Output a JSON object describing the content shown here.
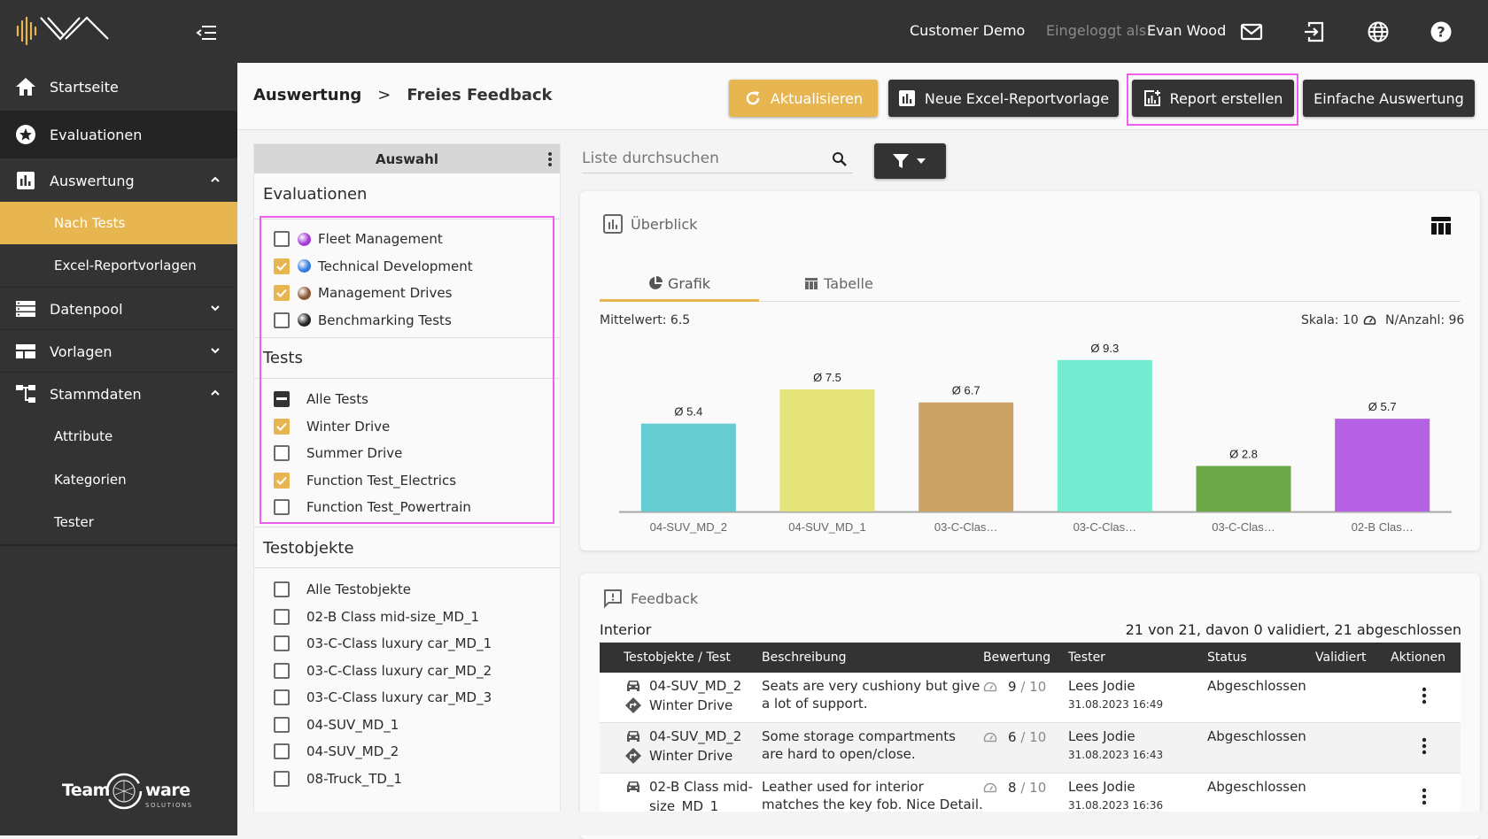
{
  "app": {
    "colors": {
      "accent": "#e8b651",
      "dark": "#333333",
      "highlight": "#ef5fef"
    }
  },
  "sidebar": {
    "logo_icon": "nva-logo",
    "collapse_icon": "menu-collapse-icon",
    "items": [
      {
        "label": "Startseite",
        "icon": "home-icon"
      },
      {
        "label": "Evaluationen",
        "icon": "star-circle-icon"
      },
      {
        "label": "Auswertung",
        "icon": "bar-chart-icon",
        "expanded": true,
        "children": [
          {
            "label": "Nach Tests",
            "active": true
          },
          {
            "label": "Excel-Reportvorlagen"
          }
        ]
      },
      {
        "label": "Datenpool",
        "icon": "server-icon",
        "expanded": false
      },
      {
        "label": "Vorlagen",
        "icon": "layout-icon",
        "expanded": false
      },
      {
        "label": "Stammdaten",
        "icon": "hierarchy-icon",
        "expanded": true,
        "children": [
          {
            "label": "Attribute"
          },
          {
            "label": "Kategorien"
          },
          {
            "label": "Tester"
          }
        ]
      }
    ],
    "footer_logo": {
      "name": "Team",
      "name2": "ware",
      "tagline": "SOLUTIONS"
    }
  },
  "topbar": {
    "customer": "Customer Demo",
    "logged_in_label": "Eingeloggt als:",
    "user": "Evan Wood",
    "icons": [
      "mail-icon",
      "logout-icon",
      "globe-icon",
      "help-icon"
    ]
  },
  "header": {
    "breadcrumb": [
      "Auswertung",
      "Freies Feedback"
    ],
    "buttons": {
      "refresh": "Aktualisieren",
      "new_excel": "Neue Excel-Reportvorlage",
      "create_report": "Report erstellen",
      "simple": "Einfache Auswertung"
    }
  },
  "selection_panel": {
    "title": "Auswahl",
    "evaluations_title": "Evaluationen",
    "evaluations": [
      {
        "label": "Fleet Management",
        "checked": false,
        "color": "#a23bd6"
      },
      {
        "label": "Technical Development",
        "checked": true,
        "color": "#2f7be0"
      },
      {
        "label": "Management Drives",
        "checked": true,
        "color": "#8a5531"
      },
      {
        "label": "Benchmarking Tests",
        "checked": false,
        "color": "#222222"
      }
    ],
    "tests_title": "Tests",
    "tests": [
      {
        "label": "Alle Tests",
        "state": "indeterminate"
      },
      {
        "label": "Winter Drive",
        "state": "checked"
      },
      {
        "label": "Summer Drive",
        "state": "unchecked"
      },
      {
        "label": "Function Test_Electrics",
        "state": "checked"
      },
      {
        "label": "Function Test_Powertrain",
        "state": "unchecked"
      }
    ],
    "objects_title": "Testobjekte",
    "objects": [
      {
        "label": "Alle Testobjekte",
        "checked": false
      },
      {
        "label": "02-B Class mid-size_MD_1",
        "checked": false
      },
      {
        "label": "03-C-Class luxury car_MD_1",
        "checked": false
      },
      {
        "label": "03-C-Class luxury car_MD_2",
        "checked": false
      },
      {
        "label": "03-C-Class luxury car_MD_3",
        "checked": false
      },
      {
        "label": "04-SUV_MD_1",
        "checked": false
      },
      {
        "label": "04-SUV_MD_2",
        "checked": false
      },
      {
        "label": "08-Truck_TD_1",
        "checked": false
      }
    ]
  },
  "search": {
    "placeholder": "Liste durchsuchen",
    "value": ""
  },
  "overview": {
    "title": "Überblick",
    "tabs": [
      {
        "label": "Grafik",
        "active": true
      },
      {
        "label": "Tabelle",
        "active": false
      }
    ],
    "mean_label": "Mittelwert: 6.5",
    "scale_label": "Skala: 10",
    "count_label": "N/Anzahl: 96"
  },
  "chart_data": {
    "type": "bar",
    "title": "",
    "xlabel": "",
    "ylabel": "",
    "ylim": [
      0,
      10
    ],
    "grid": false,
    "value_prefix": "Ø ",
    "categories": [
      "04-SUV_MD_2",
      "04-SUV_MD_1",
      "03-C-Clas…",
      "03-C-Clas…",
      "03-C-Clas…",
      "02-B Clas…"
    ],
    "values": [
      5.4,
      7.5,
      6.7,
      9.3,
      2.8,
      5.7
    ],
    "colors": [
      "#65ccd2",
      "#e5e47a",
      "#cda265",
      "#72ebd0",
      "#6ca848",
      "#b662e4"
    ]
  },
  "feedback": {
    "title": "Feedback",
    "category": "Interior",
    "summary": "21 von 21, davon 0 validiert, 21 abgeschlossen",
    "columns": [
      "Testobjekte / Test",
      "Beschreibung",
      "Bewertung",
      "Tester",
      "Status",
      "Validiert",
      "Aktionen"
    ],
    "rows": [
      {
        "object": "04-SUV_MD_2",
        "test": "Winter Drive",
        "desc1": "Seats are very cushiony but give",
        "desc2": "a lot of support.",
        "rating": "9",
        "max": "/ 10",
        "tester": "Lees Jodie",
        "date": "31.08.2023 16:49",
        "status": "Abgeschlossen"
      },
      {
        "object": "04-SUV_MD_2",
        "test": "Winter Drive",
        "desc1": "Some storage compartments",
        "desc2": "are hard to open/close.",
        "rating": "6",
        "max": "/ 10",
        "tester": "Lees Jodie",
        "date": "31.08.2023 16:43",
        "status": "Abgeschlossen"
      },
      {
        "object": "02-B Class mid-",
        "test": "size_MD_1",
        "desc1": "Leather used for interior",
        "desc2": "matches the key fob. Nice Detail.",
        "rating": "8",
        "max": "/ 10",
        "tester": "Lees Jodie",
        "date": "31.08.2023 16:36",
        "status": "Abgeschlossen"
      }
    ]
  }
}
